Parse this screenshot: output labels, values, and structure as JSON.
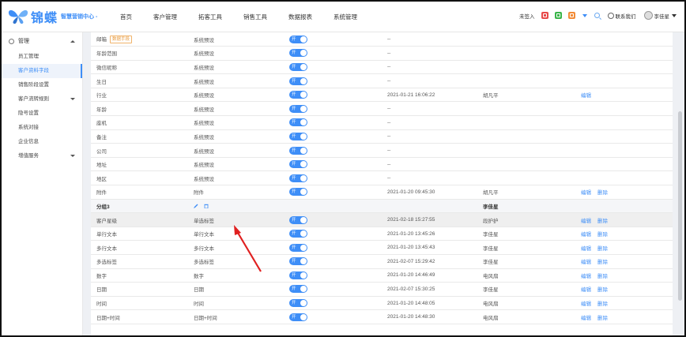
{
  "header": {
    "brand": "锦蝶",
    "subtitle": "智慧营销中心 -",
    "nav": [
      "首页",
      "客户管理",
      "拓客工具",
      "销售工具",
      "数据报表",
      "系统管理"
    ],
    "signin": "未签入",
    "contact": "联系我们",
    "user": "李佳星",
    "colors": {
      "accent": "#3e8ef7",
      "red": "#e84a4a",
      "green": "#3bb54a",
      "orange": "#f28c38"
    }
  },
  "sidebar": {
    "header": "管理",
    "items": [
      {
        "label": "员工管理",
        "active": false,
        "arrow": false
      },
      {
        "label": "客户资料字段",
        "active": true,
        "arrow": false
      },
      {
        "label": "销售阶段设置",
        "active": false,
        "arrow": false
      },
      {
        "label": "客户流转规则",
        "active": false,
        "arrow": true
      },
      {
        "label": "隐号设置",
        "active": false,
        "arrow": false
      },
      {
        "label": "系统对接",
        "active": false,
        "arrow": false
      },
      {
        "label": "企业信息",
        "active": false,
        "arrow": false
      },
      {
        "label": "增值服务",
        "active": false,
        "arrow": true
      }
    ]
  },
  "toggle_label": "开",
  "rows": [
    {
      "name": "邮箱",
      "badge": "数据手段",
      "type": "系统预设",
      "toggle": true,
      "time": "--",
      "user": "",
      "actions": []
    },
    {
      "name": "年龄范围",
      "type": "系统预设",
      "toggle": true,
      "time": "--",
      "user": "",
      "actions": []
    },
    {
      "name": "微信昵称",
      "type": "系统预设",
      "toggle": true,
      "time": "--",
      "user": "",
      "actions": []
    },
    {
      "name": "生日",
      "type": "系统预设",
      "toggle": true,
      "time": "--",
      "user": "",
      "actions": []
    },
    {
      "name": "行业",
      "type": "系统预设",
      "toggle": true,
      "time": "2021-01-21 16:06:22",
      "user": "胡凡平",
      "actions": [
        "编辑"
      ]
    },
    {
      "name": "年龄",
      "type": "系统预设",
      "toggle": true,
      "time": "--",
      "user": "",
      "actions": []
    },
    {
      "name": "座机",
      "type": "系统预设",
      "toggle": true,
      "time": "--",
      "user": "",
      "actions": []
    },
    {
      "name": "备注",
      "type": "系统预设",
      "toggle": true,
      "time": "--",
      "user": "",
      "actions": []
    },
    {
      "name": "公司",
      "type": "系统预设",
      "toggle": true,
      "time": "--",
      "user": "",
      "actions": []
    },
    {
      "name": "地址",
      "type": "系统预设",
      "toggle": true,
      "time": "--",
      "user": "",
      "actions": []
    },
    {
      "name": "地区",
      "type": "系统预设",
      "toggle": true,
      "time": "--",
      "user": "",
      "actions": []
    },
    {
      "name": "附件",
      "type": "附件",
      "toggle": true,
      "time": "2021-01-20 09:45:30",
      "user": "胡凡平",
      "actions": [
        "编辑",
        "删除"
      ]
    },
    {
      "group": true,
      "name": "分组3",
      "user": "李佳星"
    },
    {
      "name": "客户星级",
      "type": "单选标签",
      "toggle": true,
      "time": "2021-02-18 15:27:55",
      "user": "段护护",
      "actions": [
        "编辑",
        "删除"
      ],
      "highlight": true
    },
    {
      "name": "单行文本",
      "type": "单行文本",
      "toggle": true,
      "time": "2021-01-20 13:45:26",
      "user": "李佳星",
      "actions": [
        "编辑",
        "删除"
      ]
    },
    {
      "name": "多行文本",
      "type": "多行文本",
      "toggle": true,
      "time": "2021-01-20 13:45:43",
      "user": "李佳星",
      "actions": [
        "编辑",
        "删除"
      ]
    },
    {
      "name": "多选标签",
      "type": "多选标签",
      "toggle": true,
      "time": "2021-02-07 15:29:42",
      "user": "李佳星",
      "actions": [
        "编辑",
        "删除"
      ]
    },
    {
      "name": "数字",
      "type": "数字",
      "toggle": true,
      "time": "2021-01-20 14:46:49",
      "user": "电风扇",
      "actions": [
        "编辑",
        "删除"
      ]
    },
    {
      "name": "日期",
      "type": "日期",
      "toggle": true,
      "time": "2021-02-07 15:30:25",
      "user": "李佳星",
      "actions": [
        "编辑",
        "删除"
      ]
    },
    {
      "name": "时间",
      "type": "时间",
      "toggle": true,
      "time": "2021-01-20 14:48:05",
      "user": "电风扇",
      "actions": [
        "编辑",
        "删除"
      ]
    },
    {
      "name": "日期+时间",
      "type": "日期+时间",
      "toggle": true,
      "time": "2021-01-20 14:48:30",
      "user": "电风扇",
      "actions": [
        "编辑",
        "删除"
      ]
    }
  ]
}
